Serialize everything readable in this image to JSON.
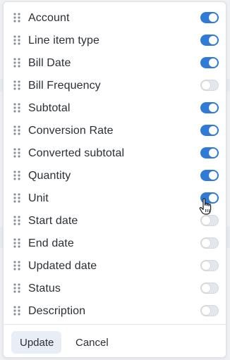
{
  "columns": [
    {
      "label": "Account",
      "enabled": true
    },
    {
      "label": "Line item type",
      "enabled": true
    },
    {
      "label": "Bill Date",
      "enabled": true
    },
    {
      "label": "Bill Frequency",
      "enabled": false
    },
    {
      "label": "Subtotal",
      "enabled": true
    },
    {
      "label": "Conversion Rate",
      "enabled": true
    },
    {
      "label": "Converted subtotal",
      "enabled": true
    },
    {
      "label": "Quantity",
      "enabled": true
    },
    {
      "label": "Unit",
      "enabled": true
    },
    {
      "label": "Start date",
      "enabled": false
    },
    {
      "label": "End date",
      "enabled": false
    },
    {
      "label": "Updated date",
      "enabled": false
    },
    {
      "label": "Status",
      "enabled": false
    },
    {
      "label": "Description",
      "enabled": false
    }
  ],
  "footer": {
    "update_label": "Update",
    "cancel_label": "Cancel"
  },
  "colors": {
    "toggle_on": "#2f7bd6",
    "toggle_off": "#e4e7eb"
  },
  "icons": {
    "handle": "drag-handle-icon",
    "cursor": "hand-pointer-icon"
  }
}
